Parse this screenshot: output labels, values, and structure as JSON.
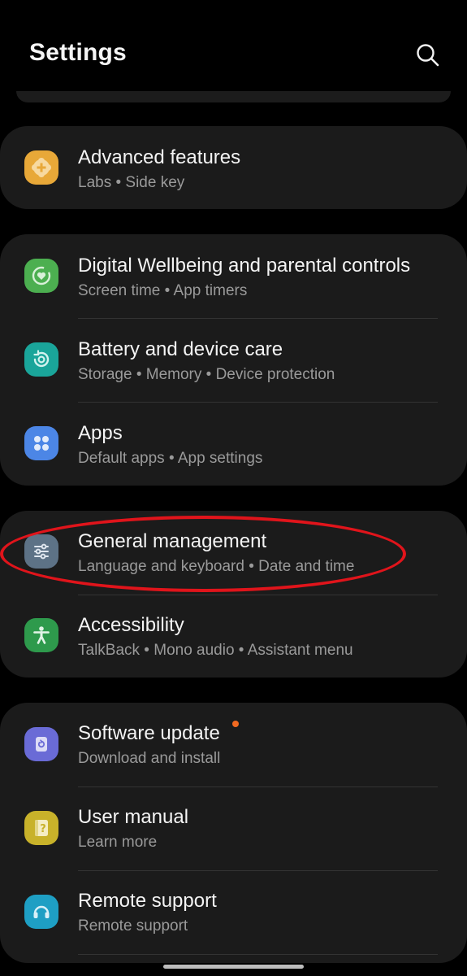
{
  "header": {
    "title": "Settings",
    "search_icon": "search-icon"
  },
  "groups": [
    {
      "items": [
        {
          "title": "Advanced features",
          "subtitle": "Labs  •  Side key",
          "icon": "plus-gear-icon",
          "icon_color": "#e8a838"
        }
      ]
    },
    {
      "items": [
        {
          "title": "Digital Wellbeing and parental controls",
          "subtitle": "Screen time  •  App timers",
          "icon": "wellbeing-heart-icon",
          "icon_color": "#4caf50"
        },
        {
          "title": "Battery and device care",
          "subtitle": "Storage  •  Memory  •  Device protection",
          "icon": "device-care-icon",
          "icon_color": "#1aa59a"
        },
        {
          "title": "Apps",
          "subtitle": "Default apps  •  App settings",
          "icon": "apps-grid-icon",
          "icon_color": "#4c86e6"
        }
      ]
    },
    {
      "items": [
        {
          "title": "General management",
          "subtitle": "Language and keyboard  •  Date and time",
          "icon": "sliders-icon",
          "icon_color": "#5d7286"
        },
        {
          "title": "Accessibility",
          "subtitle": "TalkBack  •  Mono audio  •  Assistant menu",
          "icon": "accessibility-person-icon",
          "icon_color": "#2e9a4c"
        }
      ]
    },
    {
      "items": [
        {
          "title": "Software update",
          "subtitle": "Download and install",
          "icon": "update-icon",
          "icon_color": "#6a6bd6",
          "badge_color": "#f26a21"
        },
        {
          "title": "User manual",
          "subtitle": "Learn more",
          "icon": "manual-book-icon",
          "icon_color": "#c8b22a"
        },
        {
          "title": "Remote support",
          "subtitle": "Remote support",
          "icon": "headset-icon",
          "icon_color": "#1e9fc4"
        }
      ]
    }
  ],
  "highlight_color": "#e0141b"
}
